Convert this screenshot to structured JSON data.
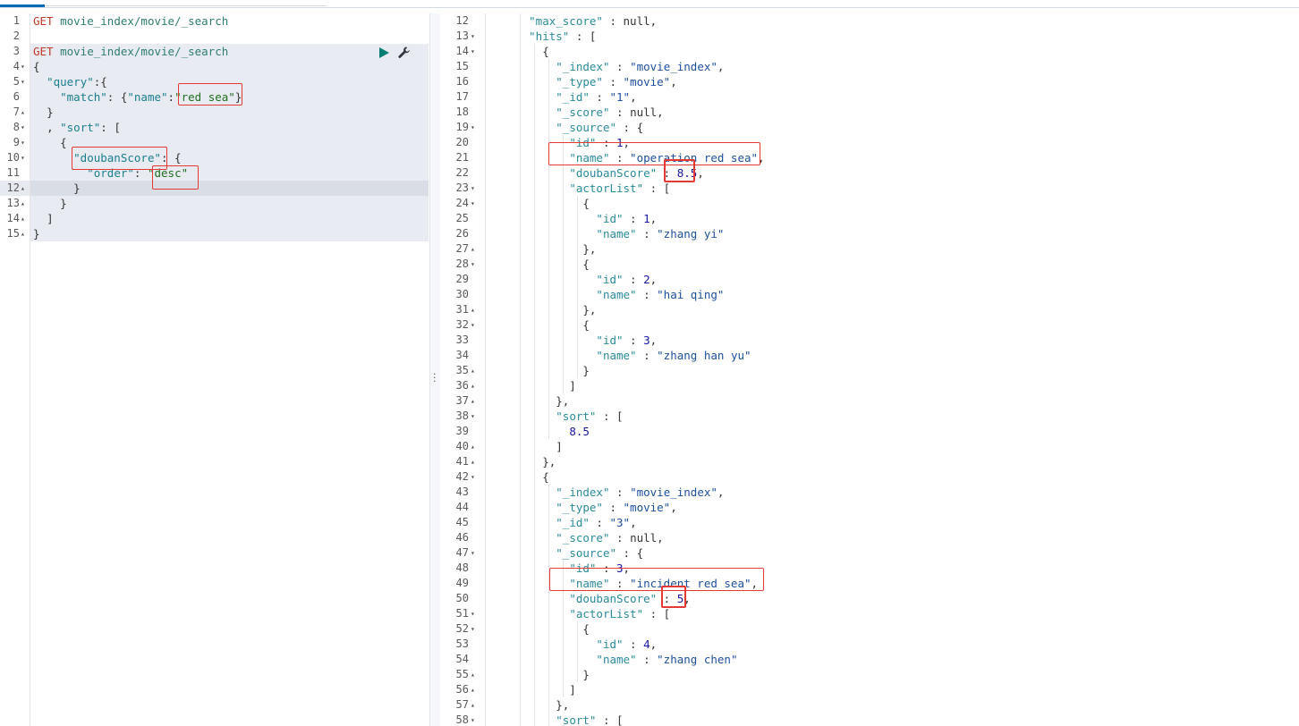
{
  "request_editor": {
    "lines": [
      {
        "num": "1",
        "fold": ""
      },
      {
        "num": "2",
        "fold": ""
      },
      {
        "num": "3",
        "fold": ""
      },
      {
        "num": "4",
        "fold": "▾"
      },
      {
        "num": "5",
        "fold": "▾"
      },
      {
        "num": "6",
        "fold": ""
      },
      {
        "num": "7",
        "fold": "▴"
      },
      {
        "num": "8",
        "fold": "▾"
      },
      {
        "num": "9",
        "fold": "▾"
      },
      {
        "num": "10",
        "fold": "▾"
      },
      {
        "num": "11",
        "fold": ""
      },
      {
        "num": "12",
        "fold": "▴"
      },
      {
        "num": "13",
        "fold": "▴"
      },
      {
        "num": "14",
        "fold": "▴"
      },
      {
        "num": "15",
        "fold": "▴"
      }
    ],
    "method_1": "GET",
    "url_1": "movie_index/movie/_search",
    "method_2": "GET",
    "url_2": "movie_index/movie/_search",
    "query_key": "\"query\"",
    "match_key": "\"match\"",
    "name_key": "\"name\"",
    "match_value": "\"red sea\"",
    "sort_key": "\"sort\"",
    "doubanscore_key": "\"doubanScore\"",
    "order_key": "\"order\"",
    "order_value": "\"desc\"",
    "run_icon": "play-icon",
    "settings_icon": "wrench-icon",
    "accent_color": "#017d73"
  },
  "response_viewer": {
    "line_numbers": [
      "12",
      "13",
      "14",
      "15",
      "16",
      "17",
      "18",
      "19",
      "20",
      "21",
      "22",
      "23",
      "24",
      "25",
      "26",
      "27",
      "28",
      "29",
      "30",
      "31",
      "32",
      "33",
      "34",
      "35",
      "36",
      "37",
      "38",
      "39",
      "40",
      "41",
      "42",
      "43",
      "44",
      "45",
      "46",
      "47",
      "48",
      "49",
      "50",
      "51",
      "52",
      "53",
      "54",
      "55",
      "56",
      "57",
      "58"
    ],
    "folds": [
      "",
      "▾",
      "▾",
      "",
      "",
      "",
      "",
      "▾",
      "",
      "",
      "",
      "▾",
      "▾",
      "",
      "",
      "▴",
      "▾",
      "",
      "",
      "▴",
      "▾",
      "",
      "",
      "▴",
      "▴",
      "▴",
      "▾",
      "",
      "▴",
      "▴",
      "▾",
      "",
      "",
      "",
      "",
      "▾",
      "",
      "",
      "",
      "▾",
      "▾",
      "",
      "",
      "▴",
      "▴",
      "▴",
      "▾"
    ],
    "max_score": {
      "key": "\"max_score\"",
      "value": "null"
    },
    "hits_key": "\"hits\"",
    "hit_1": {
      "index_key": "\"_index\"",
      "index_value": "\"movie_index\"",
      "type_key": "\"_type\"",
      "type_value": "\"movie\"",
      "id_key": "\"_id\"",
      "id_value": "\"1\"",
      "score_key": "\"_score\"",
      "score_value": "null",
      "source_key": "\"_source\"",
      "src_id_key": "\"id\"",
      "src_id_value": "1",
      "name_key": "\"name\"",
      "name_value": "\"operation red sea\"",
      "douban_key": "\"doubanScore\"",
      "douban_value": "8.5",
      "actorlist_key": "\"actorList\"",
      "actors": [
        {
          "id_key": "\"id\"",
          "id": "1",
          "name_key": "\"name\"",
          "name": "\"zhang yi\""
        },
        {
          "id_key": "\"id\"",
          "id": "2",
          "name_key": "\"name\"",
          "name": "\"hai qing\""
        },
        {
          "id_key": "\"id\"",
          "id": "3",
          "name_key": "\"name\"",
          "name": "\"zhang han yu\""
        }
      ],
      "sort_key": "\"sort\"",
      "sort_value": "8.5"
    },
    "hit_2": {
      "index_key": "\"_index\"",
      "index_value": "\"movie_index\"",
      "type_key": "\"_type\"",
      "type_value": "\"movie\"",
      "id_key": "\"_id\"",
      "id_value": "\"3\"",
      "score_key": "\"_score\"",
      "score_value": "null",
      "source_key": "\"_source\"",
      "src_id_key": "\"id\"",
      "src_id_value": "3",
      "name_key": "\"name\"",
      "name_value": "\"incident red sea\"",
      "douban_key": "\"doubanScore\"",
      "douban_value": "5",
      "actorlist_key": "\"actorList\"",
      "actors": [
        {
          "id_key": "\"id\"",
          "id": "4",
          "name_key": "\"name\"",
          "name": "\"zhang chen\""
        }
      ],
      "sort_key": "\"sort\""
    }
  },
  "colors": {
    "highlight_box": "#e53935",
    "tab_indicator": "#006bb4"
  }
}
